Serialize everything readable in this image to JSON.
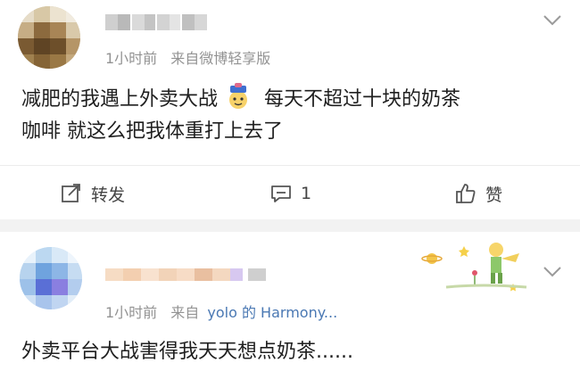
{
  "post1": {
    "meta_time": "1小时前",
    "meta_source": "来自微博轻享版",
    "text_line1_a": "减肥的我遇上外卖大战",
    "text_line1_b": "每天不超过十块的奶茶",
    "text_line2": "咖啡 就这么把我体重打上去了",
    "emoji_icon": "lurking-doll-icon",
    "actions": {
      "repost_label": "转发",
      "comment_count": "1",
      "like_label": "赞"
    }
  },
  "post2": {
    "meta_time": "1小时前",
    "meta_from": "来自",
    "meta_source_link": "yolo 的 Harmony...",
    "text": "外卖平台大战害得我天天想点奶茶......",
    "badge_icon": "little-prince-sticker-icon"
  },
  "colors": {
    "link": "#4a78b3",
    "meta": "#939393",
    "divider": "#f2f2f2"
  }
}
